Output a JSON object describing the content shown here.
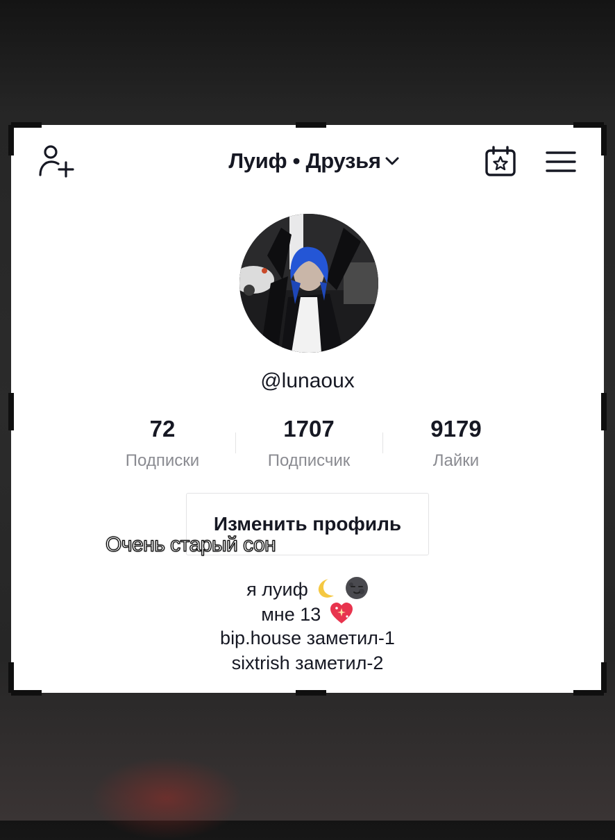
{
  "header": {
    "title": "Луиф • Друзья",
    "add_friend_icon": "add-person-icon",
    "calendar_icon": "calendar-star-icon",
    "menu_icon": "hamburger-menu-icon",
    "dropdown_icon": "chevron-down-icon"
  },
  "profile": {
    "username": "@lunaoux",
    "avatar": "profile-photo"
  },
  "stats": [
    {
      "value": "72",
      "label": "Подписки"
    },
    {
      "value": "1707",
      "label": "Подписчик"
    },
    {
      "value": "9179",
      "label": "Лайки"
    }
  ],
  "edit_button_label": "Изменить профиль",
  "caption": "Очень старый сон",
  "bio": {
    "line1": "я  луиф",
    "line2": "мне 13",
    "line3": "bip.house заметил-1",
    "line4": "sixtrish заметил-2",
    "line1_emojis": [
      "crescent-moon-icon",
      "new-moon-face-icon"
    ],
    "line2_emoji": "sparkling-heart-icon"
  },
  "colors": {
    "text_primary": "#161823",
    "text_secondary": "#8a8b91",
    "border": "#e3e3e4",
    "background": "#ffffff"
  }
}
